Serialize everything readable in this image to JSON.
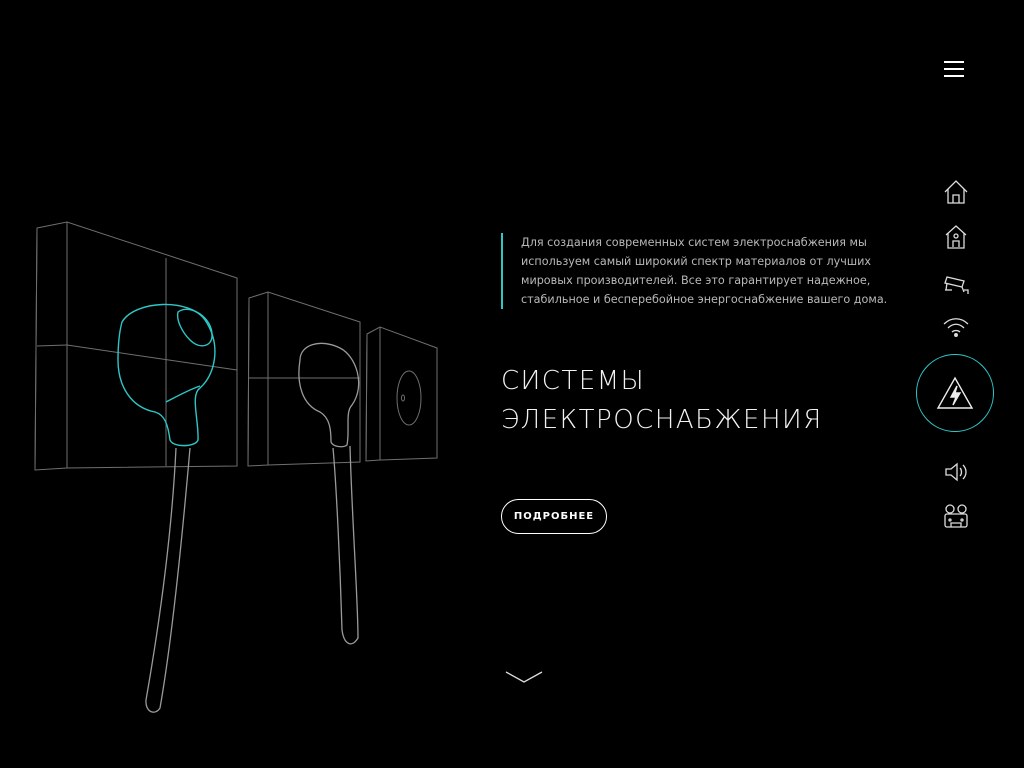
{
  "colors": {
    "accent": "#2fc6c6",
    "background": "#000000",
    "text": "#ffffff"
  },
  "header": {
    "menu_icon": "hamburger-menu-icon"
  },
  "nav": {
    "items": [
      {
        "icon": "house-icon",
        "active": false
      },
      {
        "icon": "smart-home-icon",
        "active": false
      },
      {
        "icon": "security-camera-icon",
        "active": false
      },
      {
        "icon": "wifi-icon",
        "active": false
      },
      {
        "icon": "electricity-warning-icon",
        "active": true
      },
      {
        "icon": "speaker-icon",
        "active": false
      },
      {
        "icon": "projector-icon",
        "active": false
      }
    ]
  },
  "hero": {
    "description": "Для создания современных систем электроснабжения мы используем самый широкий спектр материалов от лучших мировых производителей. Все это гарантирует надежное, стабильное и бесперебойное энергоснабжение вашего дома.",
    "title_line1": "СИСТЕМЫ",
    "title_line2": "ЭЛЕКТРОСНАБЖЕНИЯ",
    "button_label": "ПОДРОБНЕЕ"
  },
  "scroll": {
    "icon": "chevron-down-icon"
  }
}
